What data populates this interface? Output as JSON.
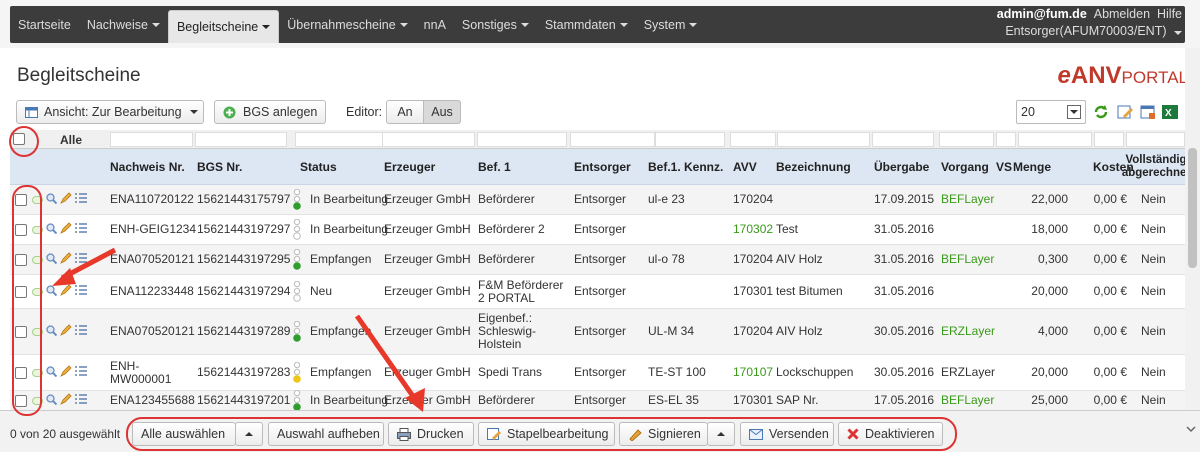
{
  "nav": {
    "items": [
      {
        "label": "Startseite",
        "caret": false,
        "active": false
      },
      {
        "label": "Nachweise",
        "caret": true,
        "active": false
      },
      {
        "label": "Begleitscheine",
        "caret": true,
        "active": true
      },
      {
        "label": "Übernahmescheine",
        "caret": true,
        "active": false
      },
      {
        "label": "nnA",
        "caret": false,
        "active": false
      },
      {
        "label": "Sonstiges",
        "caret": true,
        "active": false
      },
      {
        "label": "Stammdaten",
        "caret": true,
        "active": false
      },
      {
        "label": "System",
        "caret": true,
        "active": false
      }
    ],
    "user": "admin@fum.de",
    "logout": "Abmelden",
    "help": "Hilfe",
    "role": "Entsorger(AFUM70003/ENT)"
  },
  "page": {
    "title": "Begleitscheine",
    "logo_e": "e",
    "logo_anv": "ANV",
    "logo_portal": "PORTAL"
  },
  "toolbar": {
    "view_label": "Ansicht: Zur Bearbeitung",
    "create_label": "BGS anlegen",
    "editor_label": "Editor:",
    "editor_on": "An",
    "editor_off": "Aus",
    "page_size": "20"
  },
  "table": {
    "filter_all": "Alle",
    "headers": {
      "nachweis": "Nachweis Nr.",
      "bgs": "BGS Nr.",
      "status": "Status",
      "erzeuger": "Erzeuger",
      "bef1": "Bef. 1",
      "entsorger": "Entsorger",
      "kennz": "Bef.1. Kennz.",
      "avv": "AVV",
      "bezeichnung": "Bezeichnung",
      "uebergabe": "Übergabe",
      "vorgang": "Vorgang",
      "vs": "VS",
      "menge": "Menge",
      "kosten": "Kosten",
      "vollstaendig": "Vollständig abgerechnet"
    },
    "rows": [
      {
        "nachweis": "ENA110720122",
        "bgs": "15621443175797",
        "status": "In Bearbeitung",
        "light": "green",
        "erzeuger": "Erzeuger GmbH",
        "bef1": "Beförderer",
        "entsorger": "Entsorger",
        "kennz": "ul-e 23",
        "avv": "170204",
        "avv_green": false,
        "bezeichnung": "",
        "uebergabe": "17.09.2015",
        "vorgang": "BEFLayer",
        "vorgang_green": true,
        "menge": "22,000",
        "kosten": "0,00 €",
        "vollstaendig": "Nein"
      },
      {
        "nachweis": "ENH-GEIG1234",
        "bgs": "15621443197297",
        "status": "In Bearbeitung",
        "light": "none",
        "erzeuger": "Erzeuger GmbH",
        "bef1": "Beförderer 2",
        "entsorger": "Entsorger",
        "kennz": "",
        "avv": "170302",
        "avv_green": true,
        "bezeichnung": "Test",
        "uebergabe": "31.05.2016",
        "vorgang": "",
        "vorgang_green": false,
        "menge": "18,000",
        "kosten": "0,00 €",
        "vollstaendig": "Nein"
      },
      {
        "nachweis": "ENA070520121",
        "bgs": "15621443197295",
        "status": "Empfangen",
        "light": "green",
        "erzeuger": "Erzeuger GmbH",
        "bef1": "Beförderer",
        "entsorger": "Entsorger",
        "kennz": "ul-o 78",
        "avv": "170204",
        "avv_green": false,
        "bezeichnung": "AIV Holz",
        "uebergabe": "31.05.2016",
        "vorgang": "BEFLayer",
        "vorgang_green": true,
        "menge": "0,300",
        "kosten": "0,00 €",
        "vollstaendig": "Nein"
      },
      {
        "nachweis": "ENA112233448",
        "bgs": "15621443197294",
        "status": "Neu",
        "light": "none",
        "erzeuger": "Erzeuger GmbH",
        "bef1": "F&M Beförderer 2 PORTAL",
        "entsorger": "Entsorger",
        "kennz": "",
        "avv": "170301",
        "avv_green": false,
        "bezeichnung": "test Bitumen",
        "uebergabe": "31.05.2016",
        "vorgang": "",
        "vorgang_green": false,
        "menge": "20,000",
        "kosten": "0,00 €",
        "vollstaendig": "Nein"
      },
      {
        "nachweis": "ENA070520121",
        "bgs": "15621443197289",
        "status": "Empfangen",
        "light": "green",
        "erzeuger": "Erzeuger GmbH",
        "bef1": "Eigenbef.: Schleswig-Holstein",
        "entsorger": "Entsorger",
        "kennz": "UL-M 34",
        "avv": "170204",
        "avv_green": false,
        "bezeichnung": "AIV Holz",
        "uebergabe": "30.05.2016",
        "vorgang": "ERZLayer",
        "vorgang_green": true,
        "menge": "4,000",
        "kosten": "0,00 €",
        "vollstaendig": "Nein"
      },
      {
        "nachweis": "ENH-MW000001",
        "bgs": "15621443197283",
        "status": "Empfangen",
        "light": "yellow",
        "erzeuger": "Erzeuger GmbH",
        "bef1": "Spedi Trans",
        "entsorger": "Entsorger",
        "kennz": "TE-ST 100",
        "avv": "170107",
        "avv_green": true,
        "bezeichnung": "Lockschuppen",
        "uebergabe": "30.05.2016",
        "vorgang": "ERZLayer",
        "vorgang_green": false,
        "menge": "20,000",
        "kosten": "0,00 €",
        "vollstaendig": "Nein"
      },
      {
        "nachweis": "ENA123455688",
        "bgs": "15621443197201",
        "status": "In Bearbeitung",
        "light": "green",
        "erzeuger": "Erzeuger GmbH",
        "bef1": "Beförderer",
        "entsorger": "Entsorger",
        "kennz": "ES-EL 35",
        "avv": "170301",
        "avv_green": false,
        "bezeichnung": "SAP Nr.",
        "uebergabe": "17.05.2016",
        "vorgang": "BEFLayer",
        "vorgang_green": true,
        "menge": "25,000",
        "kosten": "0,00 €",
        "vollstaendig": "Nein"
      }
    ]
  },
  "bottom": {
    "selected": "0 von 20 ausgewählt",
    "select_all": "Alle auswählen",
    "deselect": "Auswahl aufheben",
    "print": "Drucken",
    "batch": "Stapelbearbeitung",
    "sign": "Signieren",
    "send": "Versenden",
    "deactivate": "Deaktivieren"
  },
  "colors": {
    "accent_red": "#d33333",
    "status_green": "#3a9a1a",
    "nav_dark": "#3c3c3c",
    "header_blue": "#dde6f3"
  }
}
